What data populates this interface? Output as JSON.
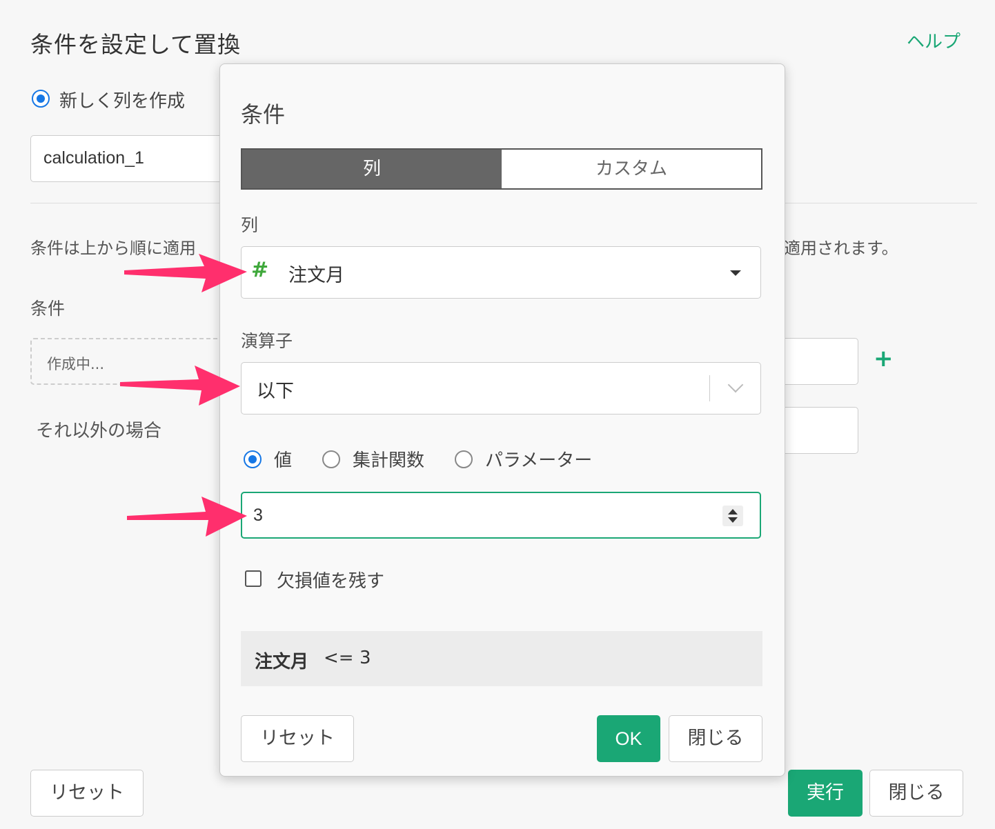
{
  "background": {
    "title": "条件を設定して置換",
    "help_link": "ヘルプ",
    "mode_option": "新しく列を作成",
    "column_name": "calculation_1",
    "note_left": "条件は上から順に適用",
    "note_right": "適用されます。",
    "conditions_label": "条件",
    "draft_condition": "作成中...",
    "else_label": "それ以外の場合",
    "reset_button": "リセット",
    "run_button": "実行",
    "close_button": "閉じる"
  },
  "popover": {
    "title": "条件",
    "tabs": [
      {
        "label": "列",
        "active": true
      },
      {
        "label": "カスタム",
        "active": false
      }
    ],
    "column_label": "列",
    "column_value": "注文月",
    "column_type_icon": "#",
    "operator_label": "演算子",
    "operator_value": "以下",
    "value_types": [
      {
        "label": "値",
        "checked": true
      },
      {
        "label": "集計関数",
        "checked": false
      },
      {
        "label": "パラメーター",
        "checked": false
      }
    ],
    "value_input": "3",
    "keep_na_label": "欠損値を残す",
    "keep_na_checked": false,
    "preview": {
      "column": "注文月",
      "operator": "<=",
      "value": "3"
    },
    "reset_button": "リセット",
    "ok_button": "OK",
    "close_button": "閉じる"
  },
  "colors": {
    "accent_green": "#1aa775",
    "radio_blue": "#1677e5",
    "annotation_arrow": "#ff2f6d",
    "active_tab": "#666666"
  }
}
